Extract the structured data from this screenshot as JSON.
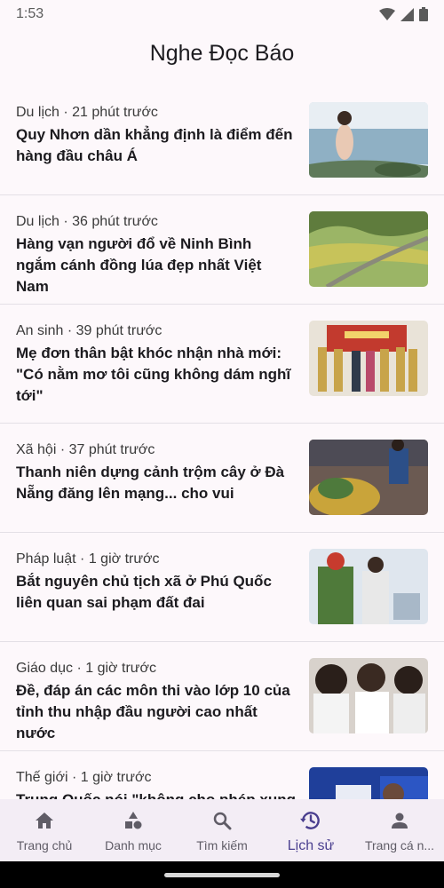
{
  "status": {
    "time": "1:53"
  },
  "app": {
    "title": "Nghe Đọc Báo"
  },
  "articles": [
    {
      "category": "Du lịch",
      "time": "21 phút trước",
      "meta": "Du lịch · 21 phút trước",
      "title": "Quy Nhơn dần khẳng định là điểm đến hàng đầu châu Á",
      "thumbnail": "beach-photo"
    },
    {
      "category": "Du lịch",
      "time": "36 phút trước",
      "meta": "Du lịch · 36 phút trước",
      "title": "Hàng vạn người đổ về Ninh Bình ngắm cánh đồng lúa đẹp nhất Việt Nam",
      "thumbnail": "rice-field-photo"
    },
    {
      "category": "An sinh",
      "time": "39 phút trước",
      "meta": "An sinh · 39 phút trước",
      "title": "Mẹ đơn thân bật khóc nhận nhà mới: \"Có nằm mơ tôi cũng không dám nghĩ tới\"",
      "thumbnail": "ceremony-photo"
    },
    {
      "category": "Xã hội",
      "time": "37 phút trước",
      "meta": "Xã hội · 37 phút trước",
      "title": "Thanh niên dựng cảnh trộm cây ở Đà Nẵng đăng lên mạng... cho vui",
      "thumbnail": "plant-theft-photo"
    },
    {
      "category": "Pháp luật",
      "time": "1 giờ trước",
      "meta": "Pháp luật · 1 giờ trước",
      "title": "Bắt nguyên chủ tịch xã ở Phú Quốc liên quan sai phạm đất đai",
      "thumbnail": "police-photo"
    },
    {
      "category": "Giáo dục",
      "time": "1 giờ trước",
      "meta": "Giáo dục · 1 giờ trước",
      "title": "Đề, đáp án các môn thi vào lớp 10 của tỉnh thu nhập đầu người cao nhất nước",
      "thumbnail": "students-photo"
    },
    {
      "category": "Thế giới",
      "time": "1 giờ trước",
      "meta": "Thế giới · 1 giờ trước",
      "title": "Trung Quốc nói \"không cho phép xung",
      "thumbnail": "conference-photo"
    }
  ],
  "nav": [
    {
      "label": "Trang chủ",
      "icon": "home-icon"
    },
    {
      "label": "Danh mục",
      "icon": "category-icon"
    },
    {
      "label": "Tìm kiếm",
      "icon": "search-icon"
    },
    {
      "label": "Lịch sử",
      "icon": "history-icon",
      "active": true
    },
    {
      "label": "Trang cá n...",
      "icon": "person-icon"
    }
  ],
  "colors": {
    "background": "#fdf8fb",
    "nav_background": "#f3edf5",
    "accent": "#4a3f8f",
    "divider": "#e4e0e6"
  }
}
